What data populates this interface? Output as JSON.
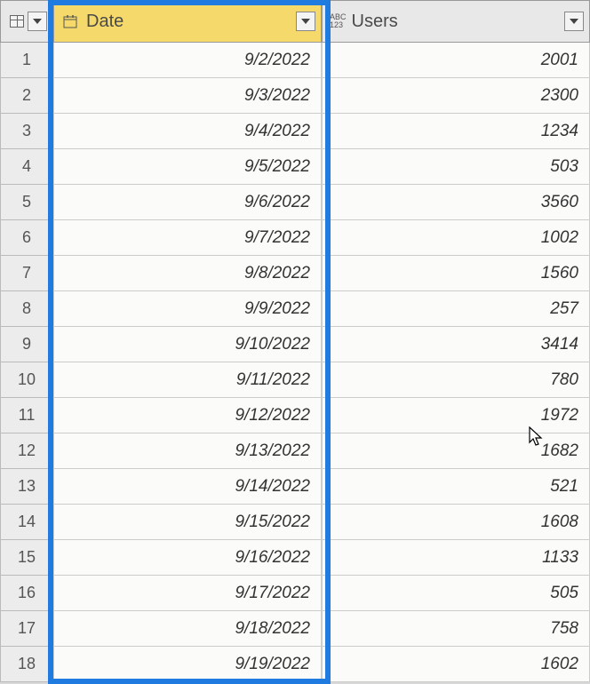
{
  "columns": {
    "date": {
      "label": "Date",
      "type_icon": "calendar"
    },
    "users": {
      "label": "Users",
      "type_icon": "abc123"
    }
  },
  "rows": [
    {
      "n": "1",
      "date": "9/2/2022",
      "users": "2001"
    },
    {
      "n": "2",
      "date": "9/3/2022",
      "users": "2300"
    },
    {
      "n": "3",
      "date": "9/4/2022",
      "users": "1234"
    },
    {
      "n": "4",
      "date": "9/5/2022",
      "users": "503"
    },
    {
      "n": "5",
      "date": "9/6/2022",
      "users": "3560"
    },
    {
      "n": "6",
      "date": "9/7/2022",
      "users": "1002"
    },
    {
      "n": "7",
      "date": "9/8/2022",
      "users": "1560"
    },
    {
      "n": "8",
      "date": "9/9/2022",
      "users": "257"
    },
    {
      "n": "9",
      "date": "9/10/2022",
      "users": "3414"
    },
    {
      "n": "10",
      "date": "9/11/2022",
      "users": "780"
    },
    {
      "n": "11",
      "date": "9/12/2022",
      "users": "1972"
    },
    {
      "n": "12",
      "date": "9/13/2022",
      "users": "1682"
    },
    {
      "n": "13",
      "date": "9/14/2022",
      "users": "521"
    },
    {
      "n": "14",
      "date": "9/15/2022",
      "users": "1608"
    },
    {
      "n": "15",
      "date": "9/16/2022",
      "users": "1133"
    },
    {
      "n": "16",
      "date": "9/17/2022",
      "users": "505"
    },
    {
      "n": "17",
      "date": "9/18/2022",
      "users": "758"
    },
    {
      "n": "18",
      "date": "9/19/2022",
      "users": "1602"
    }
  ]
}
